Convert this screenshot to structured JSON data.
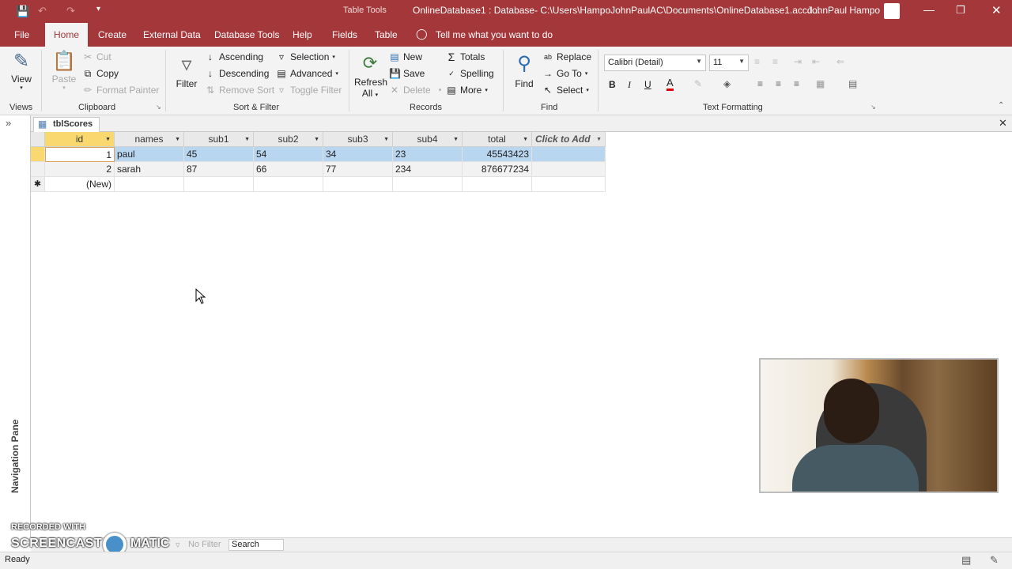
{
  "titlebar": {
    "tools_label": "Table Tools",
    "doc_title": "OnlineDatabase1 : Database- C:\\Users\\HampoJohnPaulAC\\Documents\\OnlineDatabase1.accd...",
    "user": "JohnPaul Hampo"
  },
  "tabs": [
    "File",
    "Home",
    "Create",
    "External Data",
    "Database Tools",
    "Help",
    "Fields",
    "Table"
  ],
  "tell_me": "Tell me what you want to do",
  "ribbon": {
    "views": {
      "view": "View",
      "group": "Views"
    },
    "clipboard": {
      "paste": "Paste",
      "cut": "Cut",
      "copy": "Copy",
      "format_painter": "Format Painter",
      "group": "Clipboard"
    },
    "sort_filter": {
      "filter": "Filter",
      "ascending": "Ascending",
      "descending": "Descending",
      "remove_sort": "Remove Sort",
      "selection": "Selection",
      "advanced": "Advanced",
      "toggle_filter": "Toggle Filter",
      "group": "Sort & Filter"
    },
    "records": {
      "refresh": "Refresh",
      "refresh_all": "All",
      "new": "New",
      "save": "Save",
      "delete": "Delete",
      "totals": "Totals",
      "spelling": "Spelling",
      "more": "More",
      "group": "Records"
    },
    "find": {
      "find": "Find",
      "replace": "Replace",
      "goto": "Go To",
      "select": "Select",
      "group": "Find"
    },
    "text_formatting": {
      "font": "Calibri (Detail)",
      "size": "11",
      "bold": "B",
      "italic": "I",
      "underline": "U",
      "group": "Text Formatting"
    }
  },
  "object_tab": "tblScores",
  "nav_pane_label": "Navigation Pane",
  "datasheet": {
    "columns": [
      "id",
      "names",
      "sub1",
      "sub2",
      "sub3",
      "sub4",
      "total",
      "Click to Add"
    ],
    "rows": [
      {
        "id": "1",
        "names": "paul",
        "sub1": "45",
        "sub2": "54",
        "sub3": "34",
        "sub4": "23",
        "total": "45543423"
      },
      {
        "id": "2",
        "names": "sarah",
        "sub1": "87",
        "sub2": "66",
        "sub3": "77",
        "sub4": "234",
        "total": "876677234"
      }
    ],
    "new_row_label": "(New)"
  },
  "record_nav": {
    "filter": "No Filter",
    "search": "Search"
  },
  "status": {
    "text": "Ready"
  },
  "watermark": {
    "line1": "RECORDED WITH",
    "line2": "SCREENCAST",
    "line3": "MATIC"
  },
  "colors": {
    "accent": "#a4373a",
    "row_selected": "#b8d6f0",
    "header_active": "#f9d96f"
  }
}
